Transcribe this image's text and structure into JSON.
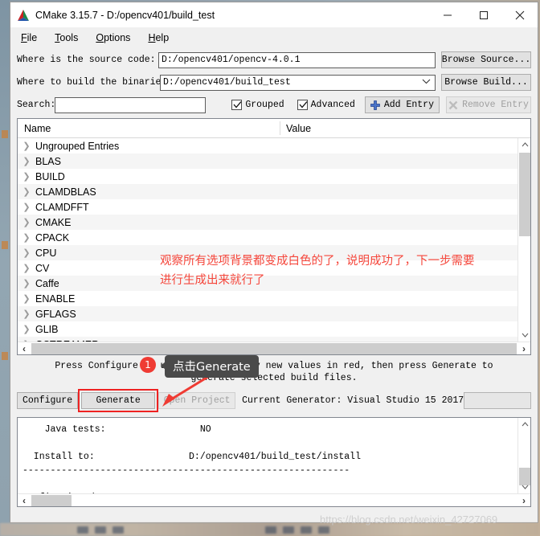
{
  "window": {
    "title": "CMake 3.15.7 - D:/opencv401/build_test",
    "icon": "cmake-logo-icon",
    "controls": {
      "minimize": "minimize-icon",
      "maximize": "maximize-icon",
      "close": "close-icon"
    }
  },
  "menubar": {
    "items": [
      {
        "label": "File",
        "mnemonic": "F"
      },
      {
        "label": "Tools",
        "mnemonic": "T"
      },
      {
        "label": "Options",
        "mnemonic": "O"
      },
      {
        "label": "Help",
        "mnemonic": "H"
      }
    ]
  },
  "source_row": {
    "label": "Where is the source code:",
    "value": "D:/opencv401/opencv-4.0.1",
    "browse_label": "Browse Source...",
    "browse_mnemonic": "S"
  },
  "build_row": {
    "label": "Where to build the binaries:",
    "value": "D:/opencv401/build_test",
    "browse_label": "Browse Build...",
    "browse_mnemonic": "B",
    "dropdown_icon": "chevron-down-icon"
  },
  "search_row": {
    "label": "Search:",
    "value": "",
    "placeholder": "",
    "grouped_label": "Grouped",
    "grouped_checked": true,
    "advanced_label": "Advanced",
    "advanced_checked": true,
    "add_entry_label": "Add Entry",
    "add_entry_icon": "plus-icon",
    "remove_entry_label": "Remove Entry",
    "remove_entry_icon": "remove-x-icon",
    "remove_entry_disabled": true
  },
  "tree": {
    "columns": [
      "Name",
      "Value"
    ],
    "rows": [
      "Ungrouped Entries",
      "BLAS",
      "BUILD",
      "CLAMDBLAS",
      "CLAMDFFT",
      "CMAKE",
      "CPACK",
      "CPU",
      "CV",
      "Caffe",
      "ENABLE",
      "GFLAGS",
      "GLIB",
      "GSTREAMER"
    ],
    "expander_icon": "chevron-right-icon"
  },
  "hint": "Press Configure to update and display new values in red, then press Generate to generate selected build files.",
  "actions": {
    "configure_label": "Configure",
    "configure_mnemonic": "C",
    "generate_label": "Generate",
    "generate_mnemonic": "G",
    "open_project_label": "Open Project",
    "open_project_disabled": true,
    "generator_text": "Current Generator: Visual Studio 15 2017",
    "progress_value": ""
  },
  "log": {
    "text": "    Java tests:                 NO\n\n  Install to:                 D:/opencv401/build_test/install\n-----------------------------------------------------------\n\nConfiguring done"
  },
  "annotations": {
    "note_line1": "观察所有选项背景都变成白色的了，说明成功了，下一步需要",
    "note_line2": "进行生成出来就行了",
    "tooltip": "点击Generate",
    "badge": "1",
    "arrow_icon": "red-arrow-icon",
    "highlight_color": "#ee2222",
    "note_color": "#f5473c"
  },
  "watermark": {
    "text": "https://blog.csdn.net/weixin_42727069"
  }
}
